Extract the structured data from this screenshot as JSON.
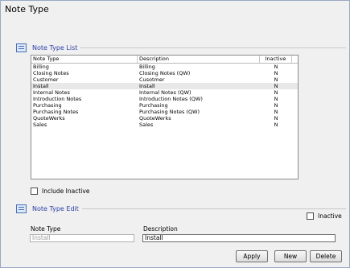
{
  "window": {
    "title": "Note Type"
  },
  "list_section": {
    "label": "Note Type List"
  },
  "list": {
    "columns": [
      "Note Type",
      "Description",
      "Inactive"
    ],
    "rows": [
      [
        "Billing",
        "Billing",
        "N"
      ],
      [
        "Closing Notes",
        "Closing Notes (QW)",
        "N"
      ],
      [
        "Customer",
        "Cusotmer",
        "N"
      ],
      [
        "Install",
        "Install",
        "N"
      ],
      [
        "Internal Notes",
        "Internal Notes (QW)",
        "N"
      ],
      [
        "Introduction Notes",
        "Introduction Notes (QW)",
        "N"
      ],
      [
        "Purchasing",
        "Purchasing",
        "N"
      ],
      [
        "Purchasing Notes",
        "Purchasing Notes (QW)",
        "N"
      ],
      [
        "QuoteWerks",
        "QuoteWerks",
        "N"
      ],
      [
        "Sales",
        "Sales",
        "N"
      ]
    ],
    "selected_index": 3
  },
  "include_inactive": {
    "label": "Include Inactive",
    "checked": false
  },
  "edit_section": {
    "label": "Note Type Edit"
  },
  "inactive_check": {
    "label": "Inactive",
    "checked": false
  },
  "note_type_field": {
    "label": "Note Type",
    "value": "Install"
  },
  "description_field": {
    "label": "Description",
    "value": "Install"
  },
  "buttons": {
    "apply": "Apply",
    "new": "New",
    "delete": "Delete"
  }
}
